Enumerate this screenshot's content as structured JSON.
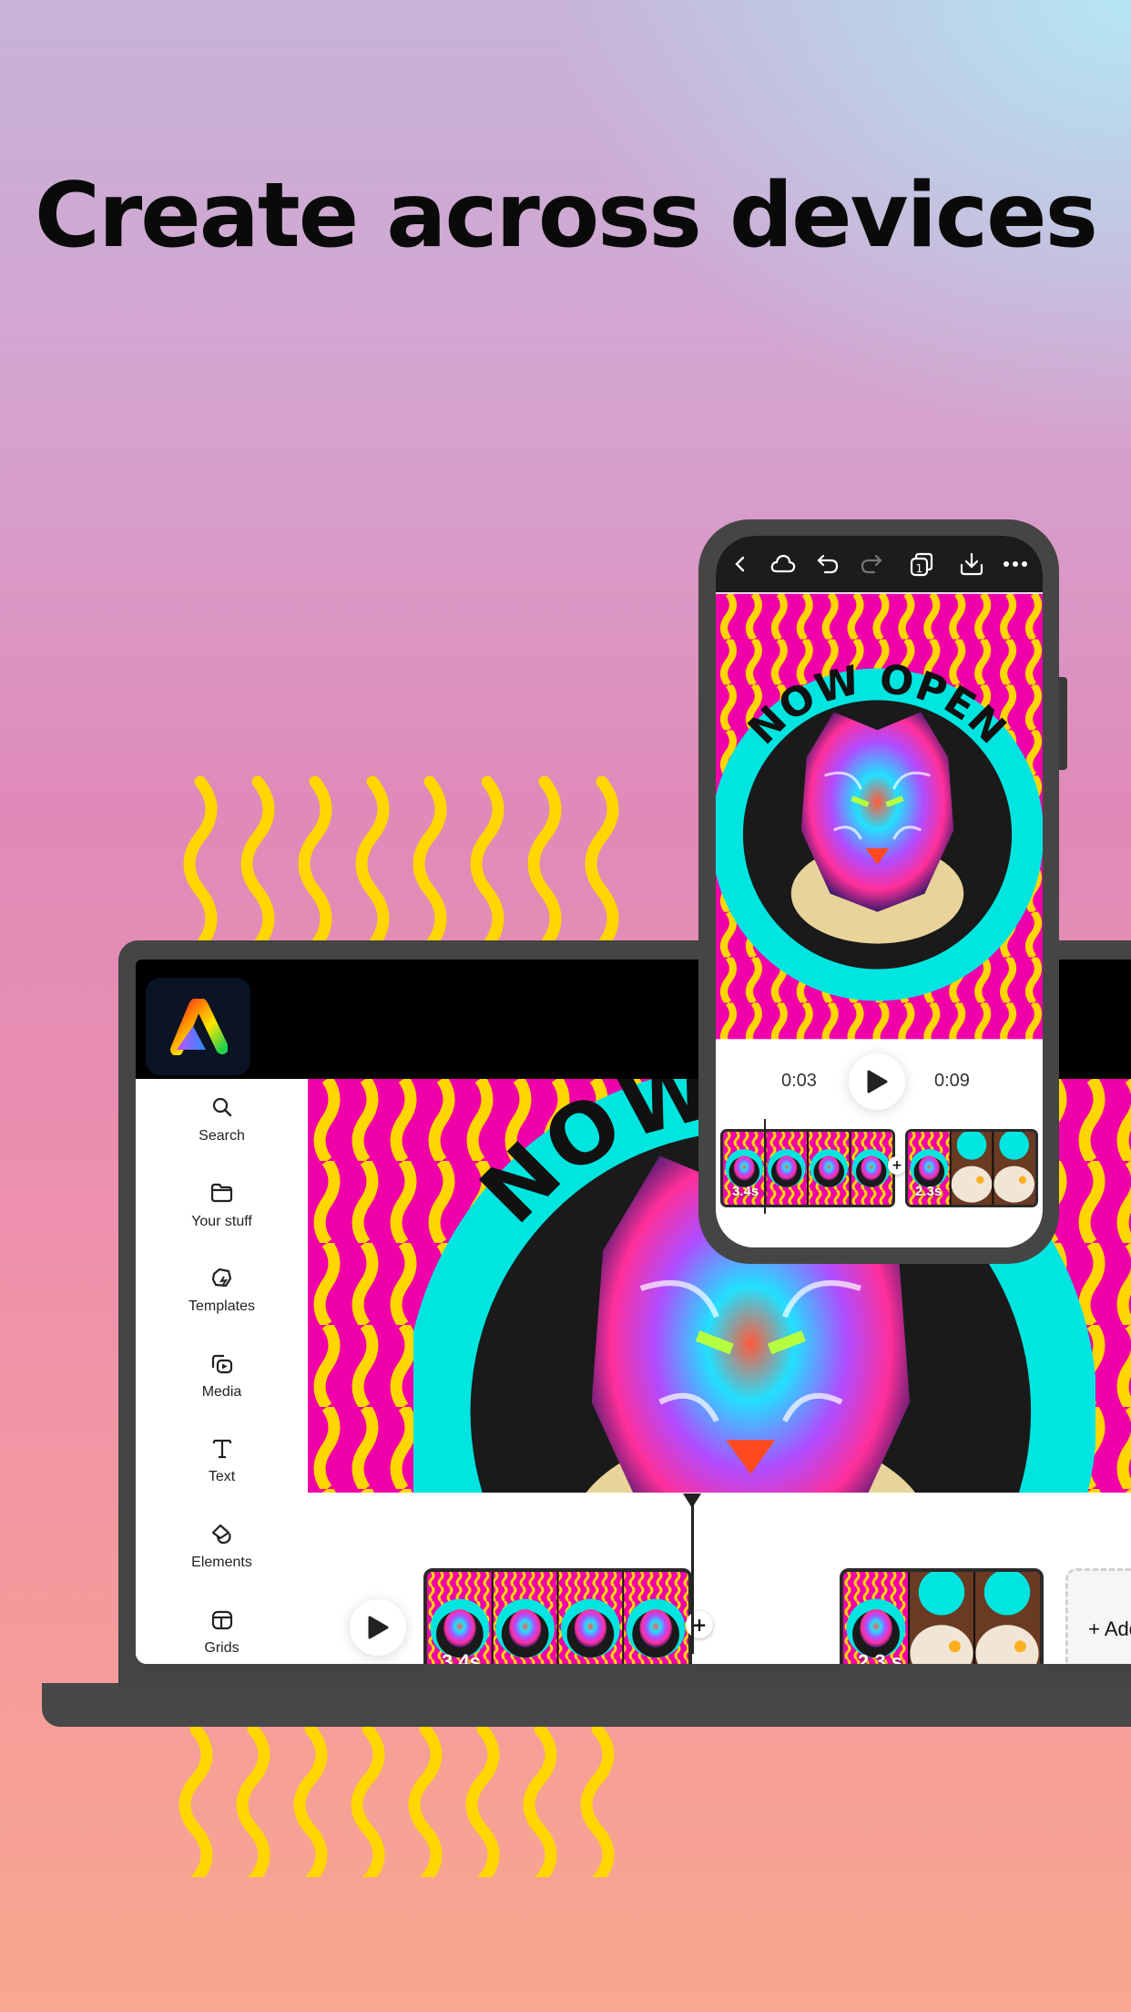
{
  "headline": "Create across devices",
  "colors": {
    "accent_yellow": "#ffd600",
    "magenta": "#f000a8",
    "cyan": "#00e5e0",
    "laptop_frame": "#444444"
  },
  "artwork": {
    "text": "NOW OPEN"
  },
  "laptop": {
    "logo": "adobe-express-logo",
    "sidebar": {
      "items": [
        {
          "label": "Search",
          "icon": "search-icon"
        },
        {
          "label": "Your stuff",
          "icon": "folder-icon"
        },
        {
          "label": "Templates",
          "icon": "templates-icon"
        },
        {
          "label": "Media",
          "icon": "media-icon"
        },
        {
          "label": "Text",
          "icon": "text-icon"
        },
        {
          "label": "Elements",
          "icon": "elements-icon"
        },
        {
          "label": "Grids",
          "icon": "grids-icon"
        }
      ]
    },
    "timeline": {
      "scenes": [
        {
          "duration": "3.4s"
        },
        {
          "duration": "2.3 s"
        }
      ],
      "add_scene_label": "+ Add scene",
      "insert_label": "+"
    }
  },
  "phone": {
    "toolbar": [
      "chevron-left-icon",
      "cloud-icon",
      "undo-icon",
      "redo-icon",
      "pages-icon",
      "download-icon",
      "more-icon"
    ],
    "pages_count": "1",
    "current_time": "0:03",
    "total_time": "0:09",
    "scenes": [
      {
        "duration": "3.4s"
      },
      {
        "duration": "2.3s"
      }
    ],
    "insert_label": "+"
  }
}
